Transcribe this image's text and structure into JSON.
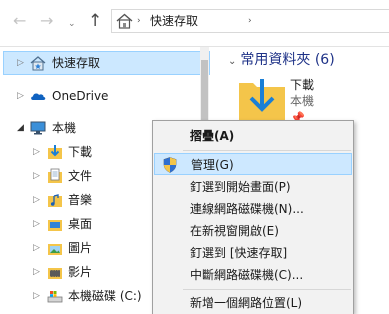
{
  "address_bar": {
    "back_glyph": "←",
    "forward_glyph": "→",
    "recent_glyph": "⌄",
    "up_glyph": "↑",
    "separator": "›",
    "crumb": "快速存取"
  },
  "nav_pane": {
    "items": [
      {
        "label": "快速存取",
        "icon": "quick-access-star-icon",
        "selected": true
      },
      {
        "label": "OneDrive",
        "icon": "onedrive-cloud-icon"
      },
      {
        "label": "本機",
        "icon": "this-pc-monitor-icon",
        "expanded": true
      },
      {
        "label": "下載",
        "icon": "downloads-folder-icon"
      },
      {
        "label": "文件",
        "icon": "documents-folder-icon"
      },
      {
        "label": "音樂",
        "icon": "music-folder-icon"
      },
      {
        "label": "桌面",
        "icon": "desktop-folder-icon"
      },
      {
        "label": "圖片",
        "icon": "pictures-folder-icon"
      },
      {
        "label": "影片",
        "icon": "videos-folder-icon"
      },
      {
        "label": "本機磁碟 (C:)",
        "icon": "local-disk-icon"
      }
    ],
    "collapsed_glyph": "▷"
  },
  "content": {
    "section_title": "常用資料夾 (6)",
    "tile": {
      "name": "下載",
      "location": "本機"
    },
    "pin_glyph": "📌"
  },
  "context_menu": {
    "items": [
      {
        "label": "摺疊(A)",
        "bold": true
      },
      {
        "label": "管理(G)",
        "highlight": true,
        "shield": true
      },
      {
        "label": "釘選到開始畫面(P)"
      },
      {
        "label": "連線網路磁碟機(N)..."
      },
      {
        "label": "在新視窗開啟(E)"
      },
      {
        "label": "釘選到 [快速存取]"
      },
      {
        "label": "中斷網路磁碟機(C)..."
      },
      {
        "label": "新增一個網路位置(L)"
      }
    ]
  },
  "colors": {
    "selection": "#cce8ff",
    "selection_border": "#99d1ff",
    "section_title": "#1e3287",
    "folder_yellow": "#f4c54a",
    "download_arrow": "#1a7fd6"
  }
}
